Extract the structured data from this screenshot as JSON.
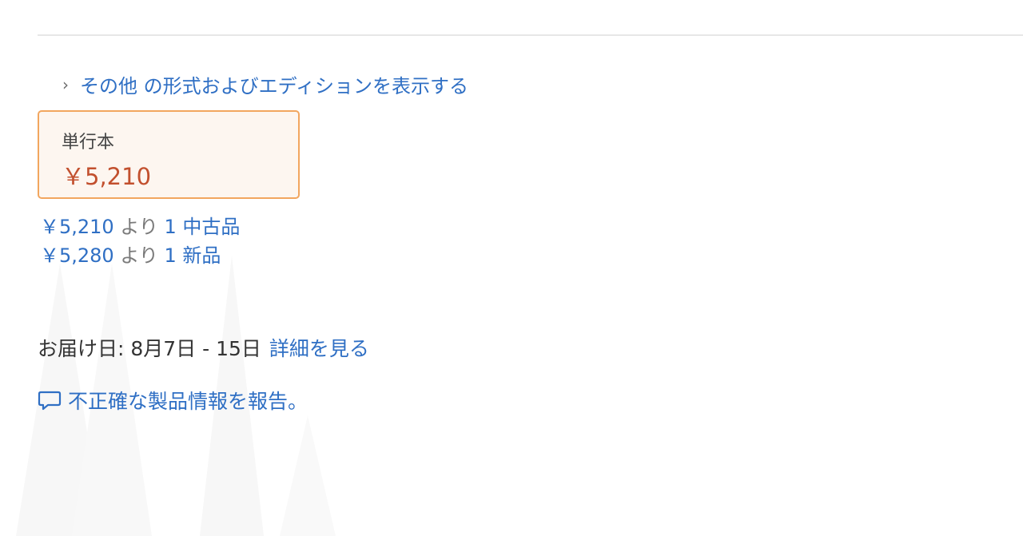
{
  "formats_link": {
    "text": "その他 の形式およびエディションを表示する"
  },
  "format_card": {
    "name": "単行本",
    "price": "￥5,210"
  },
  "offers": [
    {
      "price": "￥5,210",
      "from": "より",
      "count_label": "1 中古品"
    },
    {
      "price": "￥5,280",
      "from": "より",
      "count_label": "1 新品"
    }
  ],
  "delivery": {
    "label": "お届け日: 8月7日 - 15日",
    "details_link": "詳細を見る"
  },
  "report": {
    "text": "不正確な製品情報を報告。"
  },
  "colors": {
    "link_blue": "#2f6fc4",
    "price_red": "#c2502e",
    "selected_border": "#f2a65f",
    "selected_bg": "#fdf6f0"
  },
  "icons": [
    "chevron-right-icon",
    "speech-bubble-icon"
  ]
}
